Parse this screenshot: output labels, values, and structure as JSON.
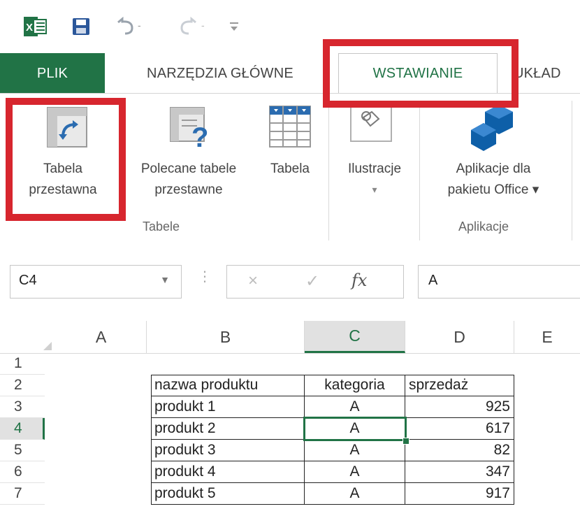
{
  "qat": {
    "app_icon": "excel-icon",
    "save_icon": "save-icon",
    "undo_icon": "undo-icon",
    "redo_icon": "redo-icon",
    "customize_icon": "customize-toolbar-icon"
  },
  "tabs": [
    {
      "label": "PLIK"
    },
    {
      "label": "NARZĘDZIA GŁÓWNE"
    },
    {
      "label": "WSTAWIANIE"
    },
    {
      "label": "UKŁAD"
    }
  ],
  "ribbon": {
    "tables_group": {
      "label": "Tabele",
      "pivot_table": {
        "line1": "Tabela",
        "line2": "przestawna"
      },
      "recommended_pivot": {
        "line1": "Polecane tabele",
        "line2": "przestawne"
      },
      "table": {
        "line1": "Tabela"
      }
    },
    "illustrations": {
      "line1": "Ilustracje",
      "dropdown": "▾"
    },
    "apps_group": {
      "label": "Aplikacje",
      "apps_for_office": {
        "line1": "Aplikacje dla",
        "line2": "pakietu Office ▾"
      }
    }
  },
  "formula_bar": {
    "name_box": "C4",
    "cancel_symbol": "×",
    "enter_symbol": "✓",
    "fx_label": "fx",
    "value": "A"
  },
  "grid": {
    "columns": [
      "A",
      "B",
      "C",
      "D",
      "E"
    ],
    "rows": [
      "1",
      "2",
      "3",
      "4",
      "5",
      "6",
      "7"
    ],
    "selected_cell": "C4",
    "table": {
      "headers": [
        "nazwa produktu",
        "kategoria",
        "sprzedaż"
      ],
      "rows": [
        [
          "produkt 1",
          "A",
          "925"
        ],
        [
          "produkt 2",
          "A",
          "617"
        ],
        [
          "produkt 3",
          "A",
          "82"
        ],
        [
          "produkt 4",
          "A",
          "347"
        ],
        [
          "produkt 5",
          "A",
          "917"
        ]
      ]
    }
  },
  "colors": {
    "excel_green": "#217346",
    "annotation_red": "#d7262e"
  }
}
